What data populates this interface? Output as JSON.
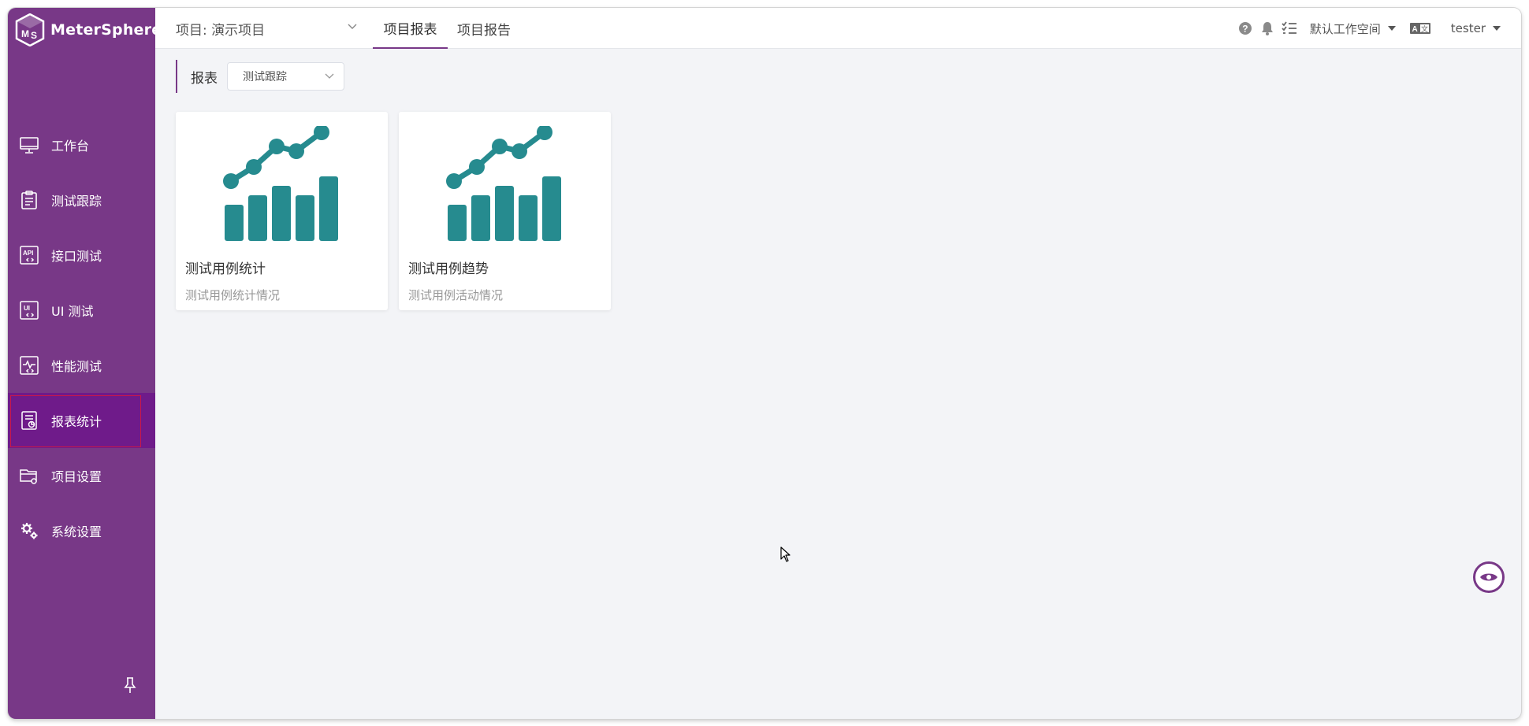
{
  "app": {
    "name": "MeterSphere"
  },
  "sidebar": {
    "items": [
      {
        "label": "工作台",
        "icon": "monitor-icon"
      },
      {
        "label": "测试跟踪",
        "icon": "clipboard-icon"
      },
      {
        "label": "接口测试",
        "icon": "api-icon"
      },
      {
        "label": "UI 测试",
        "icon": "ui-icon"
      },
      {
        "label": "性能测试",
        "icon": "performance-icon"
      },
      {
        "label": "报表统计",
        "icon": "report-icon",
        "active": true
      },
      {
        "label": "项目设置",
        "icon": "folder-settings-icon"
      },
      {
        "label": "系统设置",
        "icon": "gears-icon"
      }
    ]
  },
  "header": {
    "project_label": "项目: 演示项目",
    "tabs": [
      {
        "label": "项目报表",
        "active": true
      },
      {
        "label": "项目报告",
        "active": false
      }
    ],
    "workspace": "默认工作空间",
    "user": "tester"
  },
  "main": {
    "report_label": "报表",
    "report_type": "测试跟踪",
    "cards": [
      {
        "title": "测试用例统计",
        "desc": "测试用例统计情况",
        "icon": "chart-icon"
      },
      {
        "title": "测试用例趋势",
        "desc": "测试用例活动情况",
        "icon": "chart-icon"
      }
    ]
  },
  "colors": {
    "brand": "#783887",
    "active_item": "#6f1b8a",
    "chart_teal": "#268b8f"
  }
}
